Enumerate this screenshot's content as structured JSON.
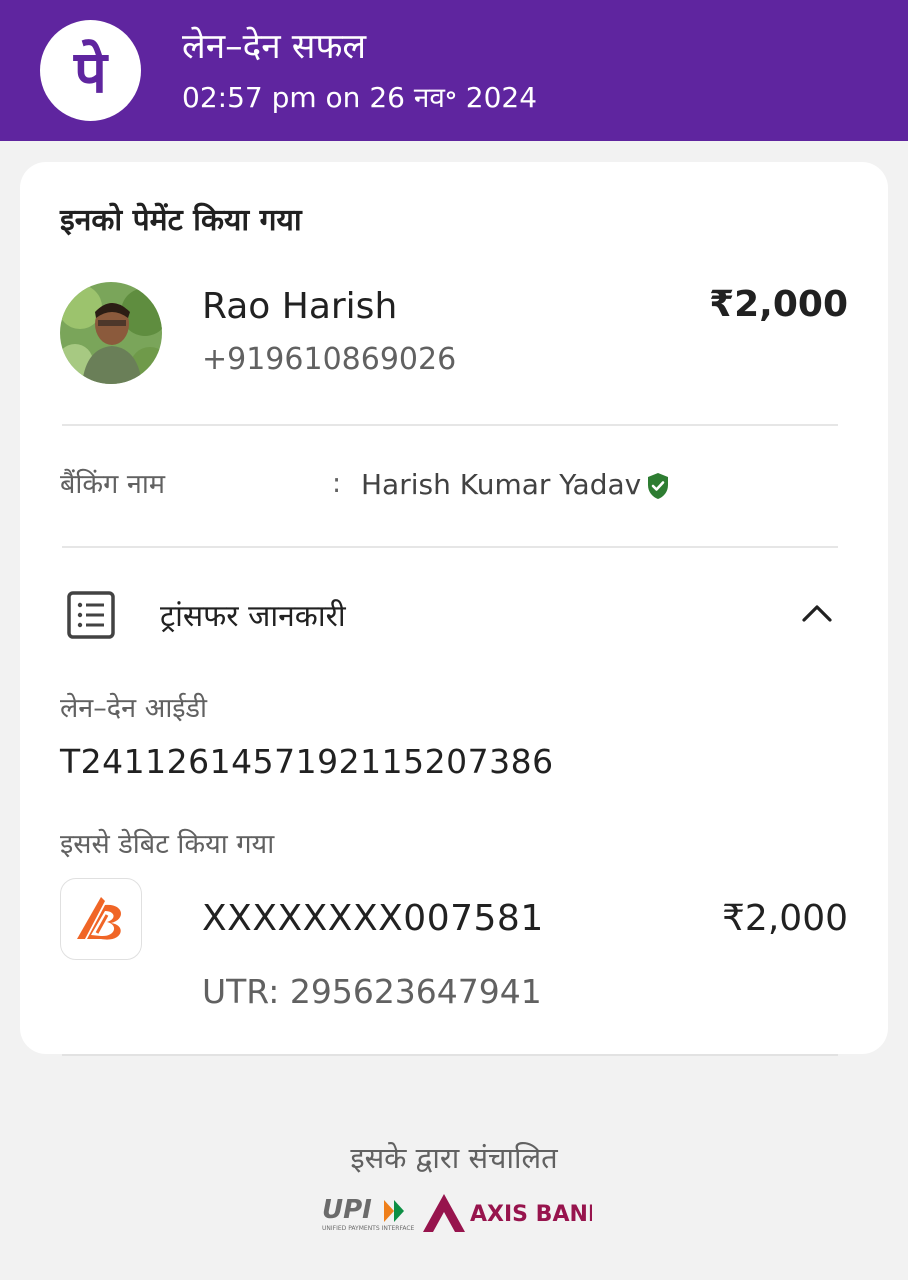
{
  "header": {
    "logo_icon": "phonepe-logo-icon",
    "title": "लेन–देन सफल",
    "subtitle": "02:57 pm on 26 नव॰ 2024",
    "color": "#5f259f"
  },
  "payee": {
    "section_heading": "इनको पेमेंट किया गया",
    "name": "Rao Harish",
    "phone": "+919610869026",
    "amount": "₹2,000",
    "banking_label": "बैंकिंग नाम",
    "banking_colon": ":",
    "banking_name": "Harish Kumar Yadav",
    "verified_icon": "verified-shield-icon",
    "verified_color": "#2e7d32"
  },
  "transfer": {
    "title": "ट्रांसफर जानकारी",
    "details_icon": "list-details-icon",
    "toggle_icon": "chevron-up-icon",
    "txn_id_label": "लेन–देन आईडी",
    "txn_id": "T2411261457192115207386",
    "debited_label": "इससे डेबिट किया गया",
    "bank_icon": "bank-of-baroda-logo-icon",
    "account": "XXXXXXXX007581",
    "account_amount": "₹2,000",
    "utr": "UTR: 295623647941"
  },
  "footer": {
    "powered_by": "इसके द्वारा संचालित",
    "upi_logo_text": "UPI",
    "upi_tagline": "UNIFIED PAYMENTS INTERFACE",
    "axis_logo_text": "AXIS BANK",
    "axis_color": "#97144d"
  }
}
